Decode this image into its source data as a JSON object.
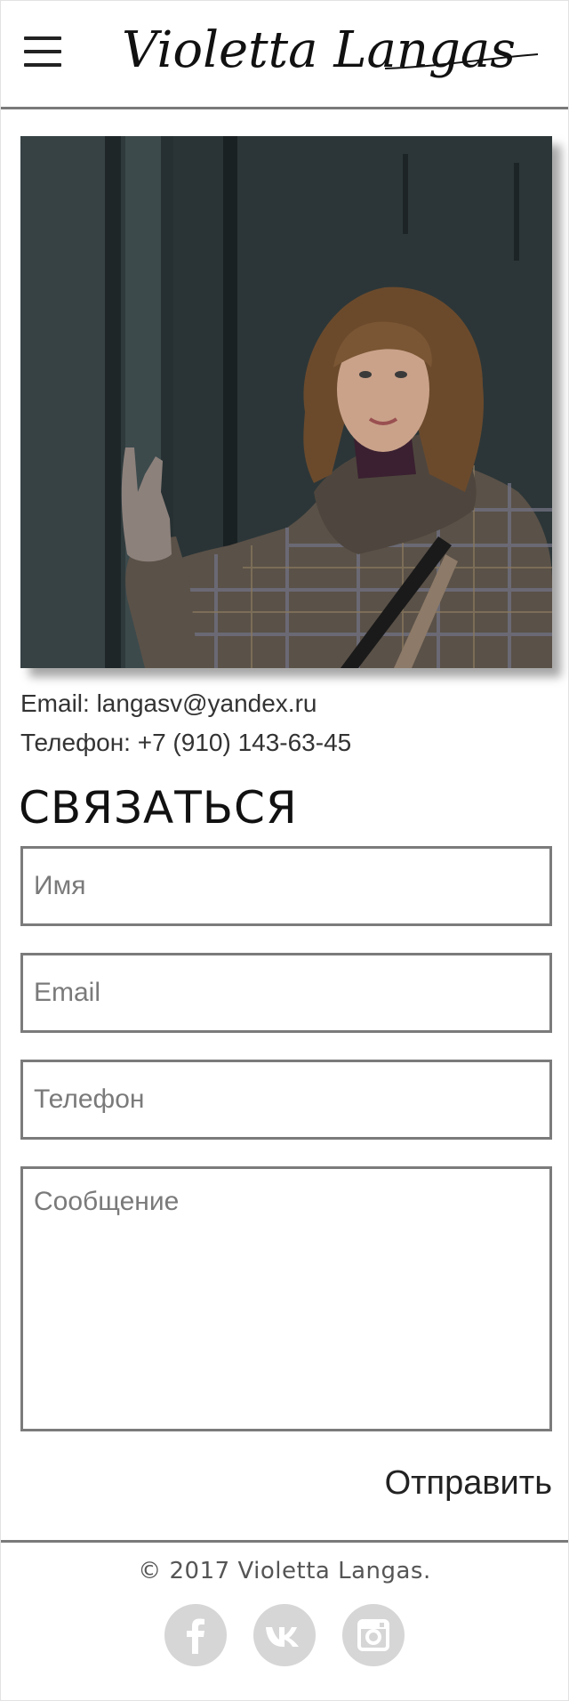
{
  "header": {
    "menu_icon": "hamburger-menu-icon",
    "logo_text": "Violetta Langas"
  },
  "photo": {
    "description_icon": "portrait-photo"
  },
  "contact": {
    "email_line": "Email: langasv@yandex.ru",
    "phone_line": "Телефон:  +7 (910) 143-63-45"
  },
  "form": {
    "title": "СВЯЗАТЬСЯ",
    "name_placeholder": "Имя",
    "email_placeholder": "Email",
    "phone_placeholder": "Телефон",
    "message_placeholder": "Сообщение",
    "submit_label": "Отправить"
  },
  "footer": {
    "copyright": "© 2017 Violetta Langas.",
    "social": [
      {
        "icon": "facebook-icon"
      },
      {
        "icon": "vk-icon"
      },
      {
        "icon": "instagram-icon"
      }
    ]
  },
  "colors": {
    "border": "#7b7b7b",
    "social_bg": "#d6d6d6",
    "text": "#333333"
  }
}
